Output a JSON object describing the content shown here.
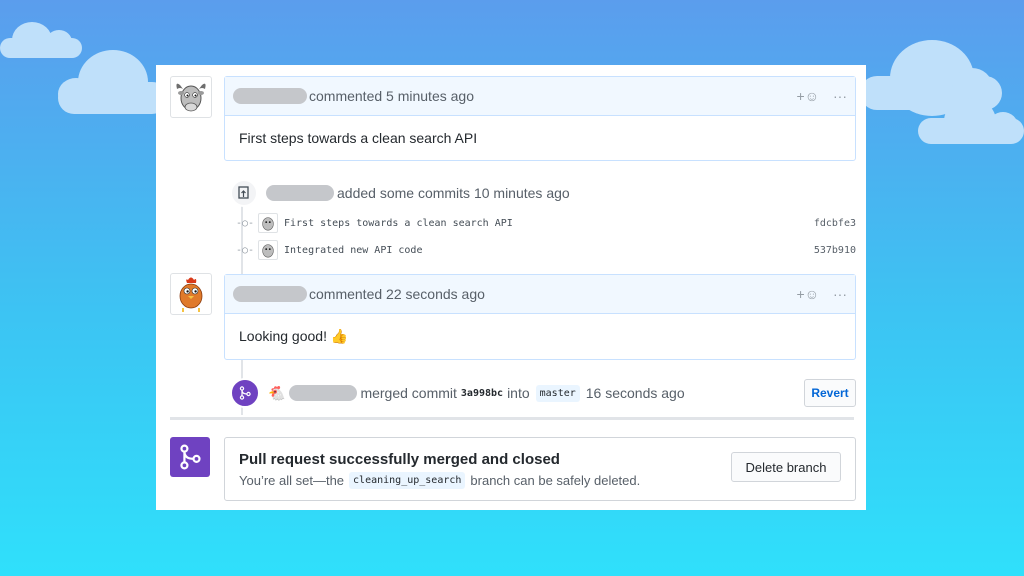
{
  "comment1": {
    "action": "commented 5 minutes ago",
    "body": "First steps towards a clean search API"
  },
  "commits_event": {
    "action": "added some commits 10 minutes ago",
    "commits": [
      {
        "message": "First steps towards a clean search API",
        "sha": "fdcbfe3"
      },
      {
        "message": "Integrated new API code",
        "sha": "537b910"
      }
    ]
  },
  "comment2": {
    "action": "commented 22 seconds ago",
    "body": "Looking good! 👍"
  },
  "merge_event": {
    "text1": "merged commit",
    "commit": "3a998bc",
    "text2": "into",
    "branch": "master",
    "time": "16 seconds ago",
    "revert_label": "Revert"
  },
  "merged": {
    "title": "Pull request successfully merged and closed",
    "text1": "You’re all set—the",
    "branch": "cleaning_up_search",
    "text2": "branch can be safely deleted.",
    "delete_label": "Delete branch"
  },
  "icons": {
    "reaction": "smiley-icon",
    "more": "kebab-icon",
    "merge": "git-merge-icon"
  },
  "colors": {
    "merge_purple": "#6f42c1",
    "header_blue": "#f1f8ff",
    "link_blue": "#0366d6"
  }
}
